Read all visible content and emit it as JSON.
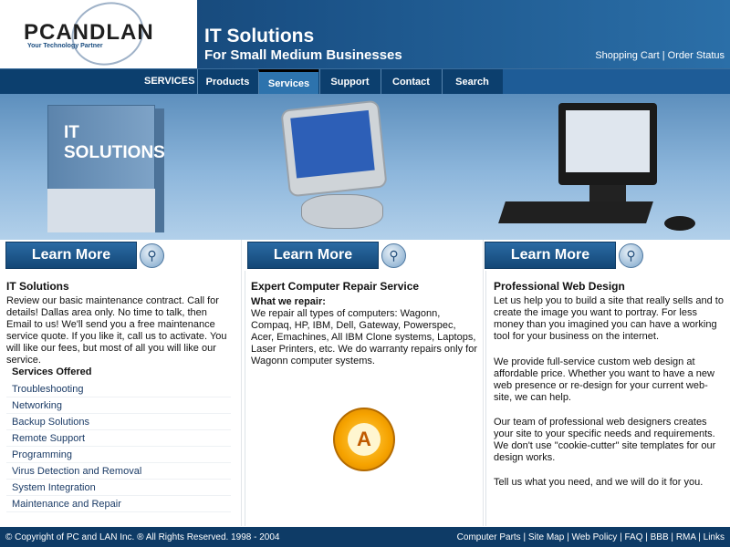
{
  "header": {
    "logo_text": "PCANDLAN",
    "logo_tagline": "Your Technology Partner",
    "title": "IT Solutions",
    "subtitle": "For Small Medium Businesses",
    "links": [
      "Shopping Cart",
      "Order Status"
    ]
  },
  "nav": {
    "section_label": "SERVICES",
    "items": [
      "Products",
      "Services",
      "Support",
      "Contact",
      "Search"
    ],
    "active": "Services"
  },
  "banner": {
    "box_label": "IT SOLUTIONS"
  },
  "learn_more": [
    "Learn More",
    "Learn More",
    "Learn More"
  ],
  "col1": {
    "title": "IT Solutions",
    "body": "Review our basic maintenance contract. Call for details! Dallas area only. No time to talk, then Email to us! We'll send you a free maintenance service quote. If you like it, call us to activate. You will like our fees, but most of all you will like our service.",
    "services_head": "Services Offered",
    "services": [
      "Troubleshooting",
      "Networking",
      "Backup Solutions",
      "Remote Support",
      "Programming",
      "Virus Detection and Removal",
      "System Integration",
      "Maintenance and Repair"
    ]
  },
  "col2": {
    "title": "Expert Computer Repair Service",
    "sub": "What we repair:",
    "body": "We repair all types of computers: Wagonn, Compaq, HP, IBM, Dell, Gateway, Powerspec, Acer, Emachines, All IBM Clone systems, Laptops, Laser Printers, etc. We do warranty repairs only for Wagonn computer systems.",
    "badge_letter": "A"
  },
  "col3": {
    "title": "Professional Web Design",
    "p1": "Let us help you to build a site that really sells and to create the image you want to portray.  For less money than you imagined you can have a working tool for your business on the internet.",
    "p2": "We provide full-service custom web design at affordable price.  Whether you want to have a new web presence or re-design for your current web-site, we can help.",
    "p3": "Our team of professional web designers creates your site to your specific needs and requirements. We don't use \"cookie-cutter\" site templates for our design works.",
    "p4": "Tell us what you need, and we will do it for you."
  },
  "footer": {
    "copyright": "©  Copyright of PC and LAN Inc. ® All Rights Reserved. 1998 - 2004",
    "links": [
      "Computer Parts",
      "Site Map",
      "Web Policy",
      "FAQ",
      "BBB",
      "RMA",
      "Links"
    ]
  }
}
